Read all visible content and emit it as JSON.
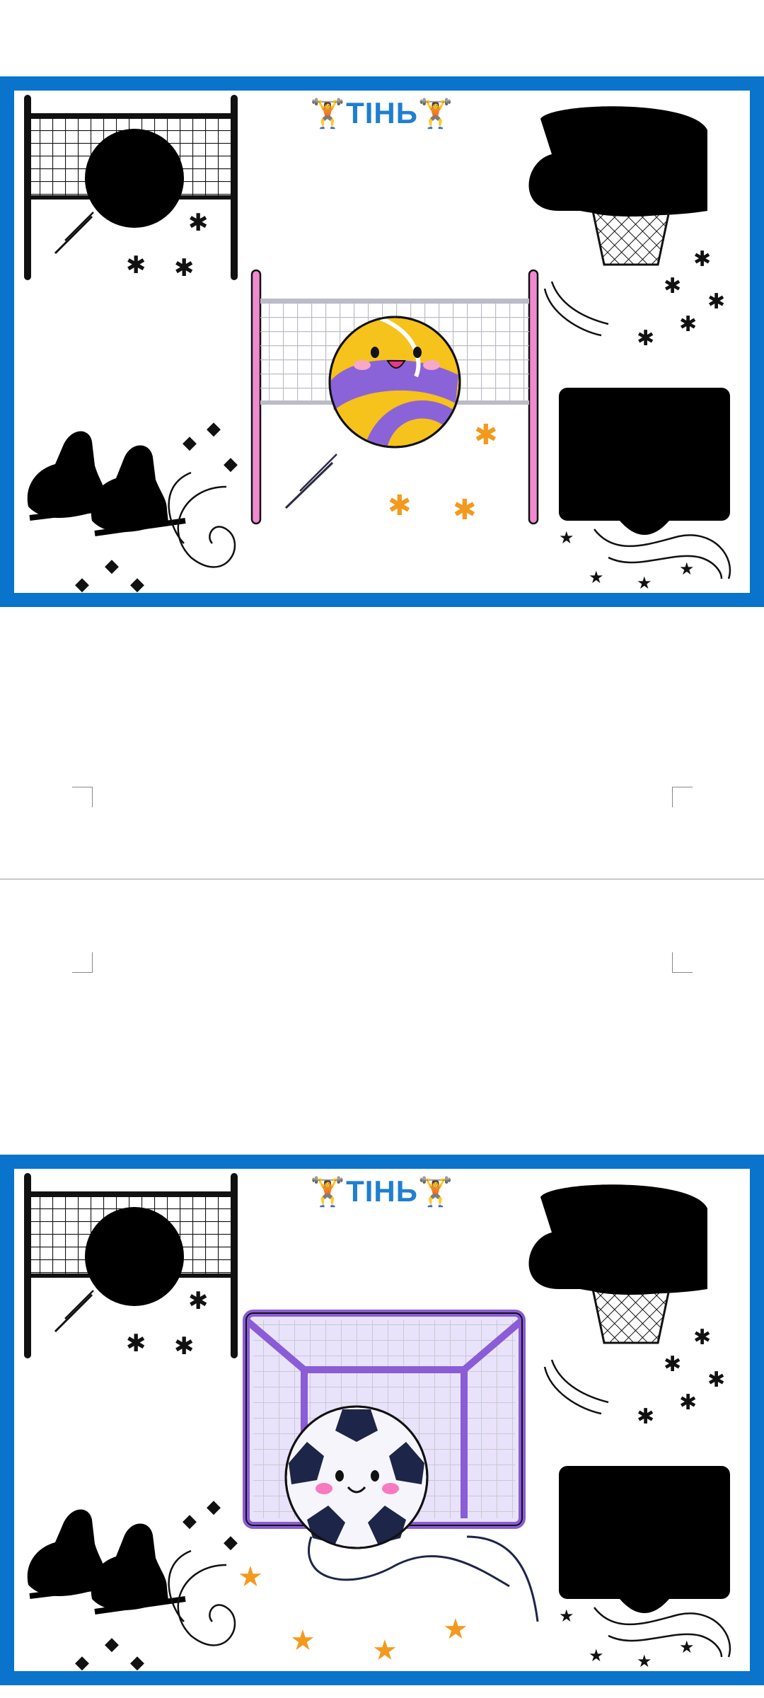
{
  "cards": [
    {
      "title": "ТІНЬ",
      "title_icon": "weightlifter-emoji",
      "title_icon_glyph": "🏋",
      "colored_item": "volleyball-net-with-ball",
      "shadow_items": [
        "volleyball-net-with-ball",
        "basketball-hoop",
        "ice-skates",
        "basketball-board"
      ]
    },
    {
      "title": "ТІНЬ",
      "title_icon": "weightlifter-emoji",
      "title_icon_glyph": "🏋",
      "colored_item": "soccer-goal-with-ball",
      "shadow_items": [
        "volleyball-net-with-ball",
        "basketball-hoop",
        "ice-skates",
        "basketball-board"
      ]
    }
  ],
  "colors": {
    "frame_blue": "#0a73cc",
    "title_blue": "#1f7fd0",
    "accent_orange": "#f39a1e",
    "net_purple": "#8a5cd6",
    "pole_pink": "#f08ad0",
    "ball_yellow": "#f6c21c",
    "ball_purple": "#8b63d8"
  }
}
